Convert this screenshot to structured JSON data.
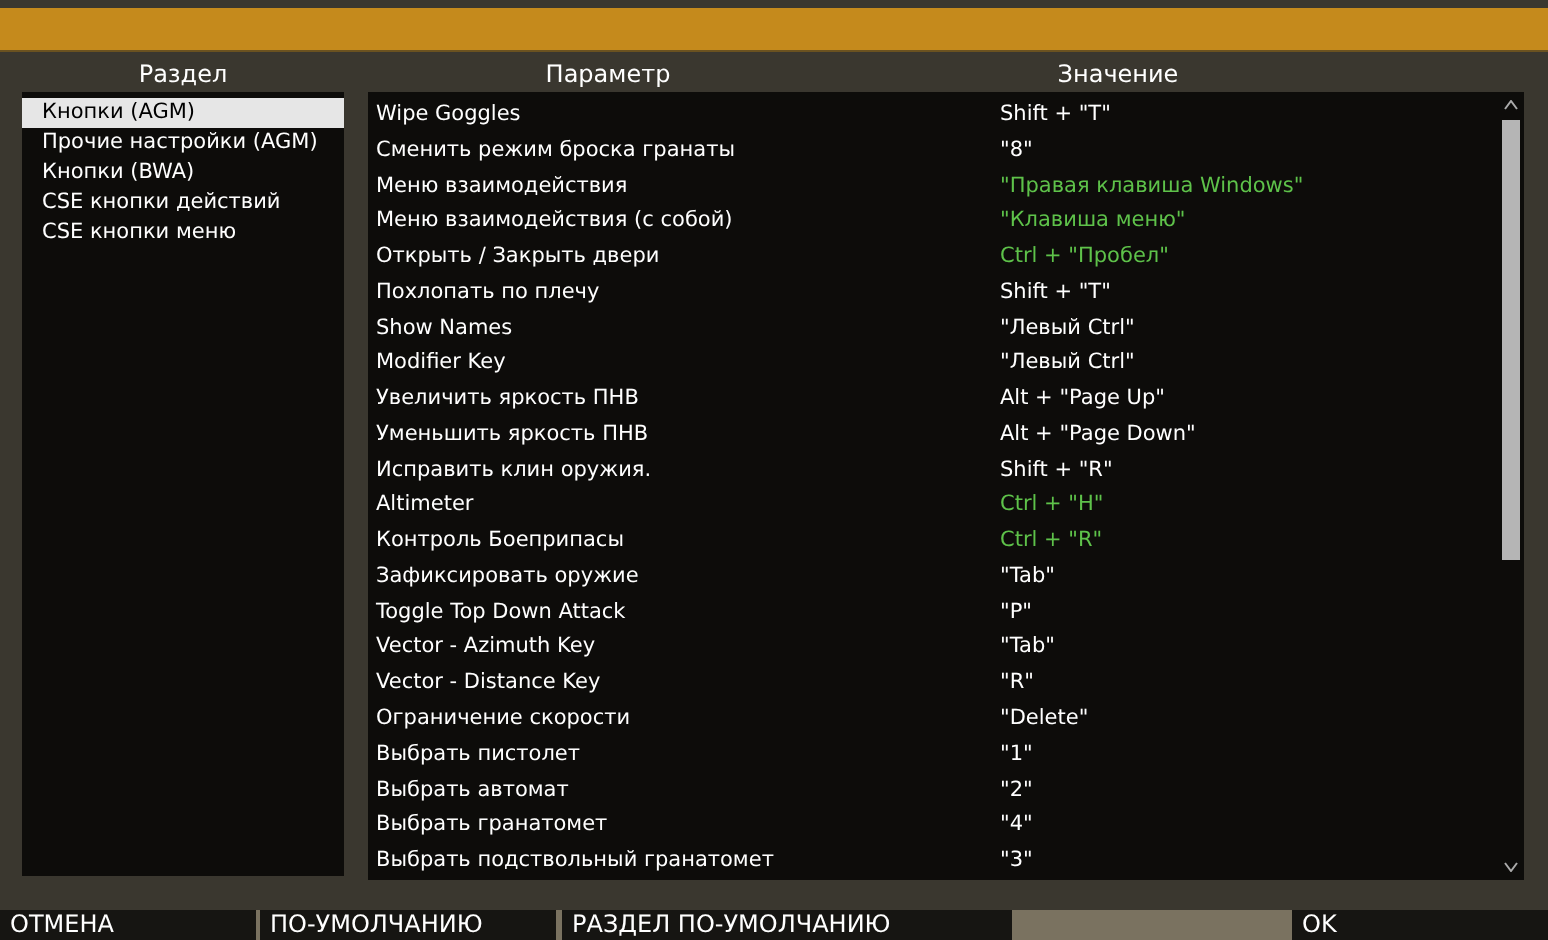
{
  "sections_header": "Раздел",
  "sections": [
    {
      "label": "Кнопки (AGM)",
      "selected": true
    },
    {
      "label": "Прочие настройки (AGM)",
      "selected": false
    },
    {
      "label": "Кнопки (BWA)",
      "selected": false
    },
    {
      "label": "CSE кнопки действий",
      "selected": false
    },
    {
      "label": "CSE кнопки меню",
      "selected": false
    }
  ],
  "table": {
    "columns": [
      "Параметр",
      "Значение"
    ],
    "rows": [
      {
        "parameter": "Wipe Goggles",
        "value": "Shift + \"T\"",
        "color": "#ffffff"
      },
      {
        "parameter": "Сменить режим броска гранаты",
        "value": "\"8\"",
        "color": "#ffffff"
      },
      {
        "parameter": "Меню взаимодействия",
        "value": "\"Правая клавиша Windows\"",
        "color": "#5ec24a"
      },
      {
        "parameter": "Меню взаимодействия (с собой)",
        "value": "\"Клавиша меню\"",
        "color": "#5ec24a"
      },
      {
        "parameter": "Открыть / Закрыть двери",
        "value": "Ctrl + \"Пробел\"",
        "color": "#5ec24a"
      },
      {
        "parameter": "Похлопать по плечу",
        "value": "Shift + \"T\"",
        "color": "#ffffff"
      },
      {
        "parameter": "Show Names",
        "value": "\"Левый Ctrl\"",
        "color": "#ffffff"
      },
      {
        "parameter": "Modifier Key",
        "value": "\"Левый Ctrl\"",
        "color": "#ffffff"
      },
      {
        "parameter": "Увеличить яркость ПНВ",
        "value": "Alt + \"Page Up\"",
        "color": "#ffffff"
      },
      {
        "parameter": "Уменьшить яркость ПНВ",
        "value": "Alt + \"Page Down\"",
        "color": "#ffffff"
      },
      {
        "parameter": "Исправить клин оружия.",
        "value": "Shift + \"R\"",
        "color": "#ffffff"
      },
      {
        "parameter": "Altimeter",
        "value": "Ctrl + \"H\"",
        "color": "#5ec24a"
      },
      {
        "parameter": "Контроль Боеприпасы",
        "value": "Ctrl + \"R\"",
        "color": "#5ec24a"
      },
      {
        "parameter": "Зафиксировать оружие",
        "value": "\"Tab\"",
        "color": "#ffffff"
      },
      {
        "parameter": "Toggle Top Down Attack",
        "value": "\"P\"",
        "color": "#ffffff"
      },
      {
        "parameter": "Vector - Azimuth Key",
        "value": "\"Tab\"",
        "color": "#ffffff"
      },
      {
        "parameter": "Vector - Distance Key",
        "value": "\"R\"",
        "color": "#ffffff"
      },
      {
        "parameter": "Ограничение скорости",
        "value": "\"Delete\"",
        "color": "#ffffff"
      },
      {
        "parameter": "Выбрать пистолет",
        "value": "\"1\"",
        "color": "#ffffff"
      },
      {
        "parameter": "Выбрать автомат",
        "value": "\"2\"",
        "color": "#ffffff"
      },
      {
        "parameter": "Выбрать гранатомет",
        "value": "\"4\"",
        "color": "#ffffff"
      },
      {
        "parameter": "Выбрать подствольный гранатомет",
        "value": "\"3\"",
        "color": "#ffffff"
      }
    ]
  },
  "buttons": [
    "ОТМЕНА",
    "ПО-УМОЛЧАНИЮ",
    "РАЗДЕЛ ПО-УМОЛЧАНИЮ",
    "OK"
  ]
}
